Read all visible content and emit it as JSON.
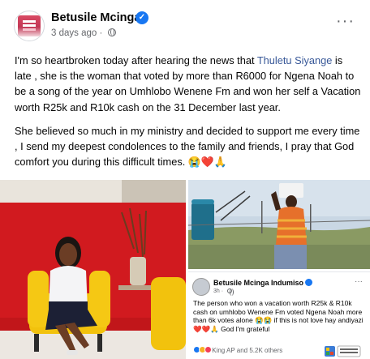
{
  "post": {
    "author": "Betusile Mcinga",
    "time": "3 days ago",
    "more": "···",
    "paragraph1_before": "I'm so heartbroken today after hearing the news that ",
    "mention": "Thuletu Siyange",
    "paragraph1_after": " is late , she is the woman that voted by more than R6000 for Ngena Noah to be a song of the year on Umhlobo Wenene Fm and won her self a Vacation worth R25k and R10k cash on the 31 December last year.",
    "paragraph2": "She believed so much in my ministry and decided to support me every time , I send my deepest condolences to the family and friends, I pray that God comfort you during this difficult times. 😭❤️🙏"
  },
  "embedded_post": {
    "author": "Betusile Mcinga Indumiso",
    "time": "3h · ",
    "text": "The person who won a vacation worth R25k & R10k cash on umhlobo Wenene Fm voted Ngena Noah more than 6k votes alone 😭😭 if this is not love hay andiyazi ❤️❤️🙏 God I'm grateful",
    "reactions": "King AP and 5.2K others",
    "more": "···"
  },
  "colors": {
    "accent": "#1877f2",
    "mention": "#385898",
    "secondary_text": "#65676b"
  },
  "icons": [
    "verified-icon",
    "globe-icon",
    "more-icon"
  ]
}
